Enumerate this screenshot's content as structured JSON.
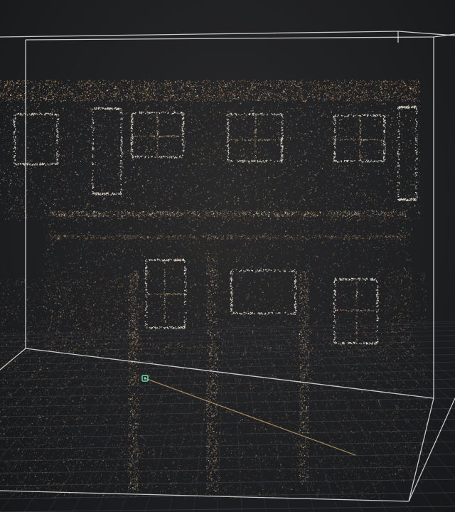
{
  "viewport": {
    "background_color": "#1e1f21",
    "grid_color": "#3c3f44",
    "bounding_box_color": "#e6e6e6",
    "point_colors": [
      "#e9e1d2",
      "#c9a27a",
      "#a77b4e",
      "#8c6a4c",
      "#d8c7a8",
      "#6e5a45"
    ],
    "gizmo_color": "#6fe0b0",
    "guide_line_color": "#c9a46a"
  }
}
